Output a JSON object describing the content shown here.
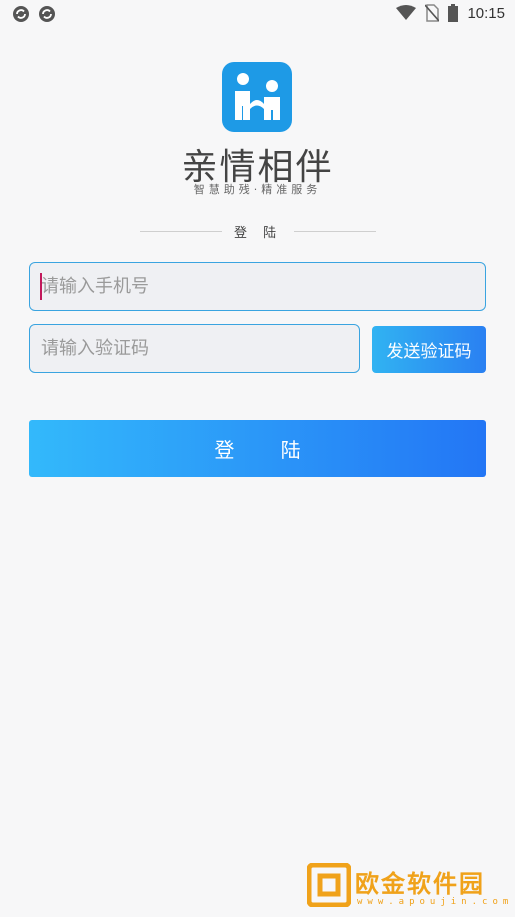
{
  "status_bar": {
    "time": "10:15",
    "left_icons": [
      "sync-icon",
      "sync-icon"
    ],
    "right_icons": [
      "wifi-icon",
      "no-sim-icon",
      "battery-icon"
    ]
  },
  "brand": {
    "app_name": "亲情相伴",
    "slogan": "智慧助残·精准服务",
    "logo_icon": "family-logo-icon",
    "logo_color": "#1e9ae6"
  },
  "login_form": {
    "section_title": "登 陆",
    "phone_placeholder": "请输入手机号",
    "code_placeholder": "请输入验证码",
    "send_code_label": "发送验证码",
    "login_label": "登 陆",
    "accent_color": "#2a8ff2"
  },
  "watermark": {
    "text": "欧金软件园",
    "url": "www.apoujin.com"
  }
}
